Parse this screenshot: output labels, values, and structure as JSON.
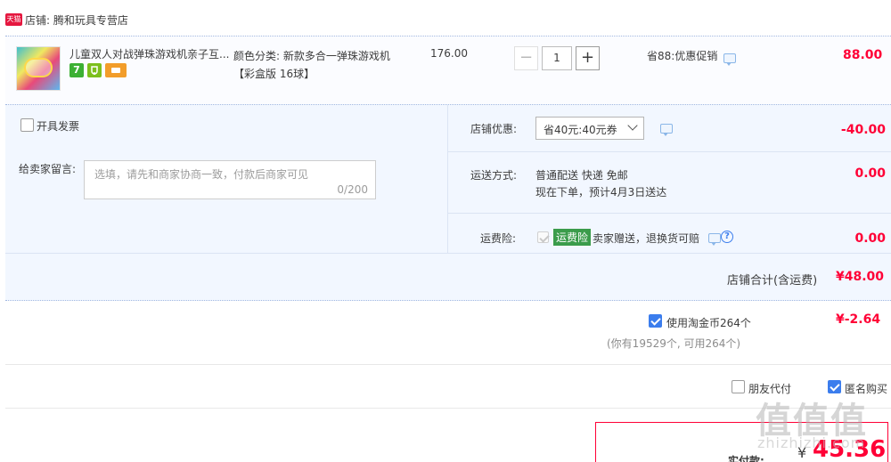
{
  "shop": {
    "badge": "天猫",
    "label": "店铺: 腾和玩具专营店"
  },
  "item": {
    "title": "儿童双人对战弹珠游戏机亲子互...",
    "spec_label": "颜色分类: 新款多合一弹珠游戏机",
    "spec_value": "【彩盒版 16球】",
    "unit_price": "176.00",
    "qty_minus": "−",
    "qty_value": "1",
    "qty_plus": "+",
    "promo": "省88:优惠促销",
    "total": "88.00",
    "service_icons": [
      "seven-day-return-icon",
      "guarantee-icon",
      "card-pay-icon"
    ],
    "service_icon_glyphs": {
      "seven": "7"
    }
  },
  "options": {
    "invoice_label": "开具发票",
    "note_label": "给卖家留言:",
    "note_placeholder": "选填，请先和商家协商一致，付款后商家可见",
    "note_count": "0/200",
    "discount_label": "店铺优惠:",
    "discount_selected": "省40元:40元券",
    "discount_amount": "-40.00",
    "shipping_label": "运送方式:",
    "shipping_method": "普通配送 快递 免邮",
    "shipping_eta": "现在下单，预计4月3日送达",
    "shipping_amount": "0.00",
    "insurance_label": "运费险:",
    "insurance_badge": "运费险",
    "insurance_text": "卖家赠送，退换货可赔",
    "insurance_help": "?",
    "insurance_amount": "0.00"
  },
  "store_total": {
    "label": "店铺合计(含运费)",
    "amount": "¥48.00"
  },
  "coins": {
    "label": "使用淘金币264个",
    "amount": "¥-2.64",
    "note": "(你有19529个, 可用264个)"
  },
  "flags": {
    "friend_pay": "朋友代付",
    "anonymous": "匿名购买"
  },
  "pay": {
    "label": "实付款:",
    "currency": "¥",
    "amount": "45.36"
  },
  "watermark": {
    "logo": "值值值",
    "text": "zhizhizhi.com"
  },
  "colors": {
    "accent_red": "#ff0036",
    "check_blue": "#3b7ded",
    "panel_bg": "#f2f7ff",
    "insurance_green": "#3b9c4b"
  }
}
